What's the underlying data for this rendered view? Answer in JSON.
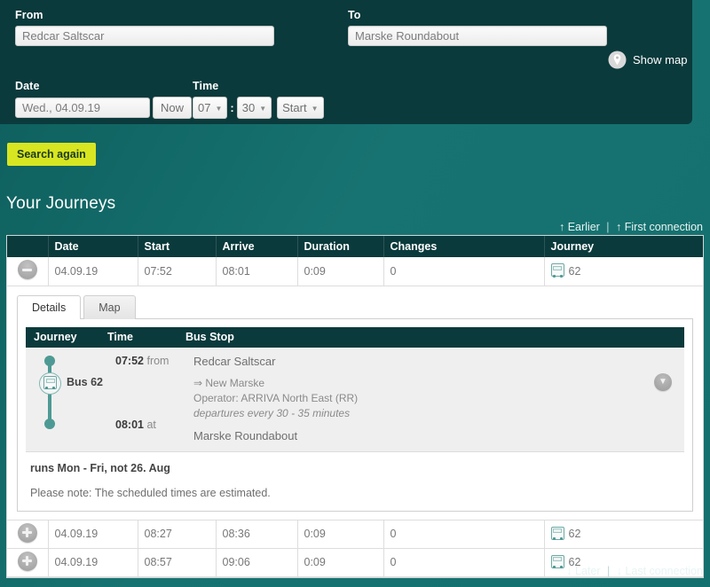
{
  "search": {
    "from_label": "From",
    "from_value": "Redcar Saltscar",
    "to_label": "To",
    "to_value": "Marske Roundabout",
    "show_map_label": "Show map",
    "show_map_icon": "map-pin-icon",
    "date_label": "Date",
    "date_value": "Wed., 04.09.19",
    "now_label": "Now",
    "time_label": "Time",
    "hour_value": "07",
    "minute_value": "30",
    "colon": ":",
    "mode_value": "Start",
    "caret_icon": "chevron-down-icon",
    "search_again_label": "Search again"
  },
  "results": {
    "title": "Your Journeys",
    "top_nav": {
      "earlier": "↑ Earlier",
      "separator": "|",
      "first_connection": "↑ First connection"
    },
    "bottom_nav": {
      "later": "↓ Later",
      "separator": "|",
      "last_connection": "↓ Last connection"
    },
    "columns": [
      "",
      "Date",
      "Start",
      "Arrive",
      "Duration",
      "Changes",
      "Journey"
    ],
    "rows": [
      {
        "toggle": "collapse",
        "date": "04.09.19",
        "start": "07:52",
        "arrive": "08:01",
        "duration": "0:09",
        "changes": "0",
        "journey_icon": "bus-icon",
        "journey": "62",
        "expanded": true
      },
      {
        "toggle": "expand",
        "date": "04.09.19",
        "start": "08:27",
        "arrive": "08:36",
        "duration": "0:09",
        "changes": "0",
        "journey_icon": "bus-icon",
        "journey": "62",
        "expanded": false
      },
      {
        "toggle": "expand",
        "date": "04.09.19",
        "start": "08:57",
        "arrive": "09:06",
        "duration": "0:09",
        "changes": "0",
        "journey_icon": "bus-icon",
        "journey": "62",
        "expanded": false
      }
    ]
  },
  "detail": {
    "tabs": [
      {
        "label": "Details",
        "active": true
      },
      {
        "label": "Map",
        "active": false
      }
    ],
    "headers": {
      "journey": "Journey",
      "time": "Time",
      "stop": "Bus Stop"
    },
    "leg": {
      "line_label": "Bus 62",
      "line_icon": "bus-icon",
      "dep_time": "07:52",
      "dep_preposition": "from",
      "dep_stop": "Redcar Saltscar",
      "direction": "⇒ New Marske",
      "operator": "Operator: ARRIVA North East (RR)",
      "frequency": "departures every 30 - 35 minutes",
      "arr_time": "08:01",
      "arr_preposition": "at",
      "arr_stop": "Marske Roundabout",
      "expand_icon": "chevron-down-icon"
    },
    "notes": {
      "runs": "runs Mon - Fri, not 26. Aug",
      "please_note": "Please note: The scheduled times are estimated."
    }
  },
  "colors": {
    "panel_dark": "#0b3a3c",
    "page_teal": "#14706e",
    "accent_yellow": "#d8e521",
    "line_teal": "#4d9a94"
  }
}
